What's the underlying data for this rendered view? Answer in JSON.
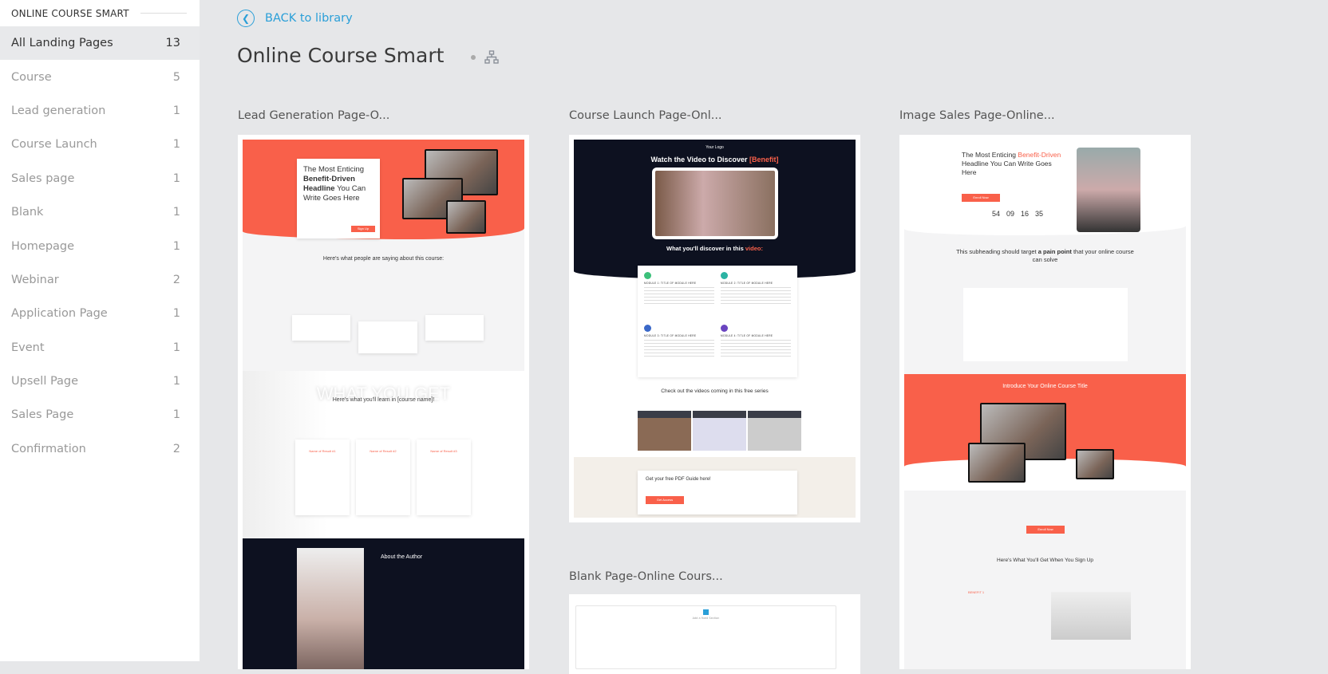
{
  "sidebar": {
    "header": "ONLINE COURSE SMART",
    "items": [
      {
        "label": "All Landing Pages",
        "count": "13",
        "active": true
      },
      {
        "label": "Course",
        "count": "5"
      },
      {
        "label": "Lead generation",
        "count": "1"
      },
      {
        "label": "Course Launch",
        "count": "1"
      },
      {
        "label": "Sales page",
        "count": "1"
      },
      {
        "label": "Blank",
        "count": "1"
      },
      {
        "label": "Homepage",
        "count": "1"
      },
      {
        "label": "Webinar",
        "count": "2"
      },
      {
        "label": "Application Page",
        "count": "1"
      },
      {
        "label": "Event",
        "count": "1"
      },
      {
        "label": "Upsell Page",
        "count": "1"
      },
      {
        "label": "Sales Page",
        "count": "1"
      },
      {
        "label": "Confirmation",
        "count": "2"
      }
    ]
  },
  "header": {
    "back_label": "BACK to library",
    "title": "Online Course Smart",
    "icons": [
      "back-circle-icon",
      "sitemap-icon"
    ]
  },
  "colors": {
    "accent": "#2a9fd8",
    "coral": "#f9604a",
    "navy": "#0d1120"
  },
  "templates": [
    {
      "title": "Lead Generation Page-O...",
      "preview": {
        "headline_a": "The Most Enticing",
        "headline_b": "Benefit-Driven Headline",
        "headline_c": "You Can Write Goes Here",
        "signup": "Sign Up",
        "testimonials_heading": "Here's what people are saying about this course:",
        "learn_heading": "Here's what you'll learn in [course name]!",
        "watermark": "WHAT YOU GET",
        "results": [
          "Name of Result #1",
          "Name of Result #2",
          "Name of Result #3"
        ],
        "author_heading": "About the Author"
      }
    },
    {
      "title": "Course Launch Page-Onl...",
      "preview": {
        "logo": "Your Logo",
        "headline": "Watch the Video to Discover",
        "headline_accent": "[Benefit]",
        "discover": "What you'll discover in this",
        "discover_accent": "video:",
        "modules": [
          "MODULE 1: TITLE OF MODULE HERE",
          "MODULE 2: TITLE OF MODULE HERE",
          "MODULE 3: TITLE OF MODULE HERE",
          "MODULE 4: TITLE OF MODULE HERE"
        ],
        "series_heading": "Check out the videos coming in this free series",
        "pdf_heading": "Get your free PDF Guide here!",
        "pdf_button": "Get Access"
      }
    },
    {
      "title": "Image Sales Page-Online...",
      "preview": {
        "headline_a": "The Most Enticing",
        "headline_accent": "Benefit-Driven",
        "headline_b": "Headline You Can Write Goes Here",
        "enroll": "Enroll Now",
        "countdown": [
          "54",
          "09",
          "16",
          "35"
        ],
        "pain_a": "This subheading should target",
        "pain_bold": "a pain point",
        "pain_b": "that your online course can solve",
        "intro": "Introduce Your Online Course Title",
        "enroll2": "Enroll Now",
        "get_heading": "Here's What You'll Get When You Sign Up",
        "benefit": "BENEFIT 1"
      }
    },
    {
      "title": "Blank Page-Online Cours...",
      "preview": {
        "add": "Add a fixed Section"
      }
    }
  ]
}
